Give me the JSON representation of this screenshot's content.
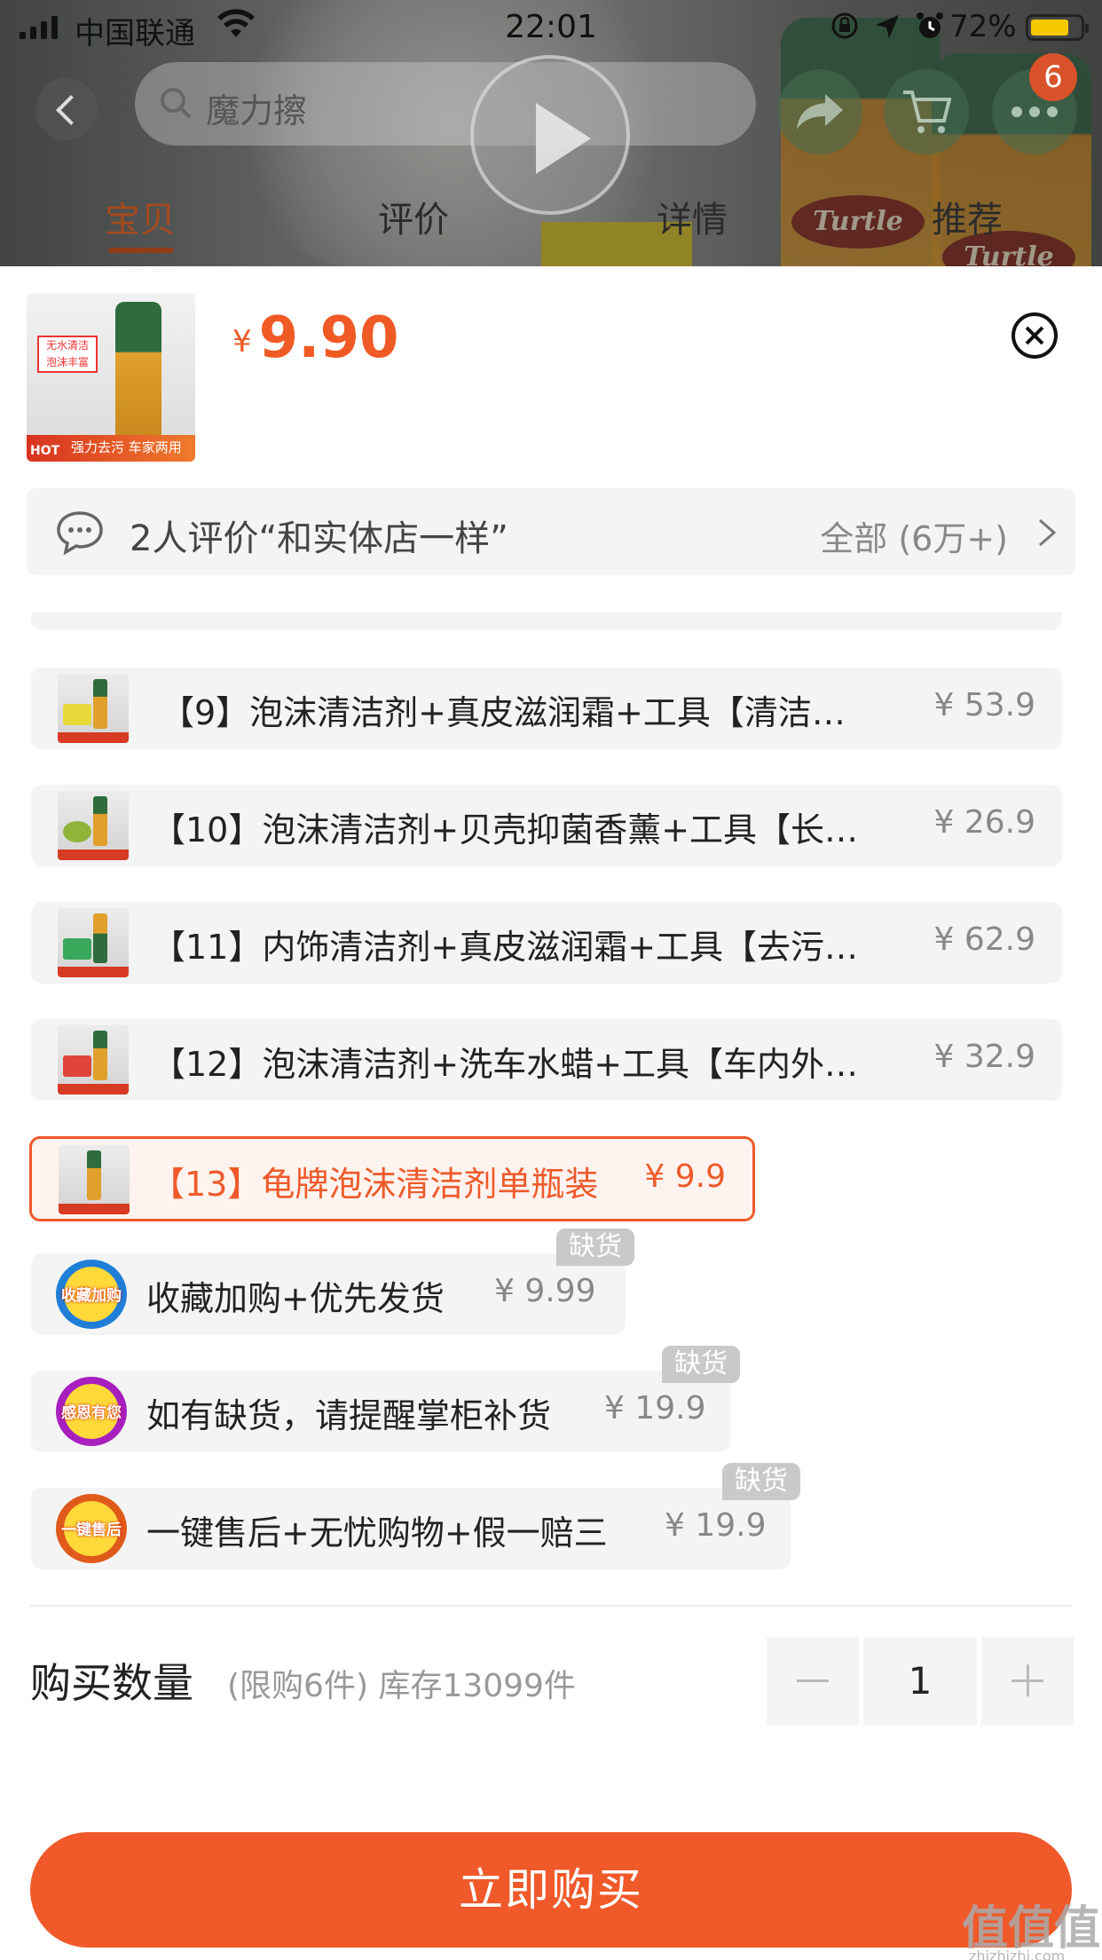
{
  "status_bar": {
    "carrier": "中国联通",
    "time": "22:01",
    "battery": "72%"
  },
  "nav": {
    "search_placeholder": "魔力擦",
    "cart_badge": "6",
    "tabs": [
      "宝贝",
      "评价",
      "详情",
      "推荐"
    ],
    "active_tab": 0
  },
  "background": {
    "can_label": "Turtle"
  },
  "product": {
    "currency": "¥",
    "price": "9.90",
    "thumb_tag_line1": "无水清洁",
    "thumb_tag_line2": "泡沫丰富",
    "thumb_hot": "HOT",
    "thumb_caption": "强力去污 车家两用"
  },
  "review": {
    "text": "2人评价“和实体店一样”",
    "all": "全部 (6万+)"
  },
  "options": [
    {
      "label": "【9】泡沫清洁剂+真皮滋润霜+工具【清洁…",
      "price": "¥ 53.9"
    },
    {
      "label": "【10】泡沫清洁剂+贝壳抑菌香薰+工具【长…",
      "price": "¥ 26.9"
    },
    {
      "label": "【11】内饰清洁剂+真皮滋润霜+工具【去污…",
      "price": "¥ 62.9"
    },
    {
      "label": "【12】泡沫清洁剂+洗车水蜡+工具【车内外…",
      "price": "¥ 32.9"
    },
    {
      "label": "【13】龟牌泡沫清洁剂单瓶装",
      "price": "¥ 9.9",
      "selected": true
    },
    {
      "label": "收藏加购+优先发货",
      "price": "¥ 9.99",
      "badge": "缺货",
      "promo": "收藏加购"
    },
    {
      "label": "如有缺货，请提醒掌柜补货",
      "price": "¥ 19.9",
      "badge": "缺货",
      "promo": "感恩有您"
    },
    {
      "label": "一键售后+无忧购物+假一赔三",
      "price": "¥ 19.9",
      "badge": "缺货",
      "promo": "一键售后"
    }
  ],
  "quantity": {
    "label": "购买数量",
    "note": "(限购6件) 库存13099件",
    "value": "1"
  },
  "buy_button": "立即购买",
  "watermark": {
    "main": "值值值",
    "sub": "zhizhizhi.com"
  },
  "colors": {
    "accent": "#f0592a",
    "option_bg": "#f4f4f4",
    "soldout_badge": "#c9c9c9"
  }
}
